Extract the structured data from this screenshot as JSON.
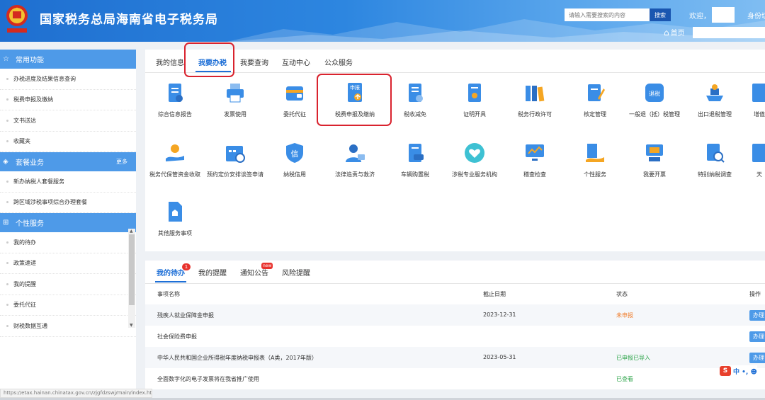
{
  "header": {
    "title": "国家税务总局海南省电子税务局",
    "search_placeholder": "请输入需要搜索的内容",
    "search_button": "搜索",
    "welcome": "欢迎，",
    "identity": "身份切",
    "home": "首页"
  },
  "sidebar": {
    "sections": [
      {
        "title": "常用功能",
        "icon": "star-icon",
        "more": "",
        "items": [
          "办税进度及结果信息查询",
          "税费申报及缴纳",
          "文书送达",
          "收藏夹"
        ]
      },
      {
        "title": "套餐业务",
        "icon": "layers-icon",
        "more": "更多",
        "items": [
          "新办纳税人套餐服务",
          "跨区域涉税事项综合办理套餐"
        ]
      },
      {
        "title": "个性服务",
        "icon": "grid-icon",
        "more": "",
        "items": [
          "我的待办",
          "政策速递",
          "我的提醒",
          "委托代征",
          "财税数据互通"
        ]
      }
    ]
  },
  "main_tabs": [
    "我的信息",
    "我要办税",
    "我要查询",
    "互动中心",
    "公众服务"
  ],
  "services": [
    {
      "label": "综合信息报告",
      "icon": "report-icon"
    },
    {
      "label": "发票使用",
      "icon": "printer-icon"
    },
    {
      "label": "委托代征",
      "icon": "wallet-icon"
    },
    {
      "label": "税费申报及缴纳",
      "icon": "declare-icon"
    },
    {
      "label": "税收减免",
      "icon": "tax-relief-icon"
    },
    {
      "label": "证明开具",
      "icon": "certificate-icon"
    },
    {
      "label": "税务行政许可",
      "icon": "license-icon"
    },
    {
      "label": "核定管理",
      "icon": "edit-icon"
    },
    {
      "label": "一般退（抵）税管理",
      "icon": "refund-icon"
    },
    {
      "label": "出口退税管理",
      "icon": "ship-icon"
    },
    {
      "label": "增值",
      "icon": "vat-icon"
    },
    {
      "label": "税务代保管资金收取",
      "icon": "hand-coin-icon"
    },
    {
      "label": "预约定价安排谈签申请",
      "icon": "calendar-icon"
    },
    {
      "label": "纳税信用",
      "icon": "credit-icon"
    },
    {
      "label": "法律追责与救济",
      "icon": "law-icon"
    },
    {
      "label": "车辆购置税",
      "icon": "vehicle-icon"
    },
    {
      "label": "涉税专业服务机构",
      "icon": "heart-icon"
    },
    {
      "label": "稽查检查",
      "icon": "monitor-icon"
    },
    {
      "label": "个性服务",
      "icon": "person-service-icon"
    },
    {
      "label": "我要开票",
      "icon": "invoice-icon"
    },
    {
      "label": "特别纳税调查",
      "icon": "search-doc-icon"
    },
    {
      "label": "天",
      "icon": "more-icon"
    },
    {
      "label": "其他服务事项",
      "icon": "other-icon"
    }
  ],
  "todo": {
    "tabs": [
      "我的待办",
      "我的提醒",
      "通知公告",
      "风险提醒"
    ],
    "badge_count": "1",
    "badge_new": "new",
    "columns": {
      "name": "事项名称",
      "deadline": "截止日期",
      "status": "状态",
      "action": "操作"
    },
    "rows": [
      {
        "name": "残疾人就业保障金申报",
        "deadline": "2023-12-31",
        "status": "未申报",
        "action": "办理"
      },
      {
        "name": "社会保险费申报",
        "deadline": "",
        "status": "",
        "action": "办理"
      },
      {
        "name": "中华人民共和国企业所得税年度纳税申报表（A类，2017年版）",
        "deadline": "2023-05-31",
        "status": "已申报已导入",
        "action": "办理"
      },
      {
        "name": "全面数字化的电子发票将在我省推广使用",
        "deadline": "",
        "status": "已查看",
        "action": ""
      }
    ]
  },
  "statusbar": "https://etax.hainan.chinatax.gov.cn/zjgfdzswj/main/index.html",
  "ime": {
    "logo": "S",
    "text": "中 •, ☻"
  },
  "colors": {
    "accent": "#1e6fd6",
    "sidebar_header": "#4e9ae8",
    "highlight": "#d9232e"
  }
}
